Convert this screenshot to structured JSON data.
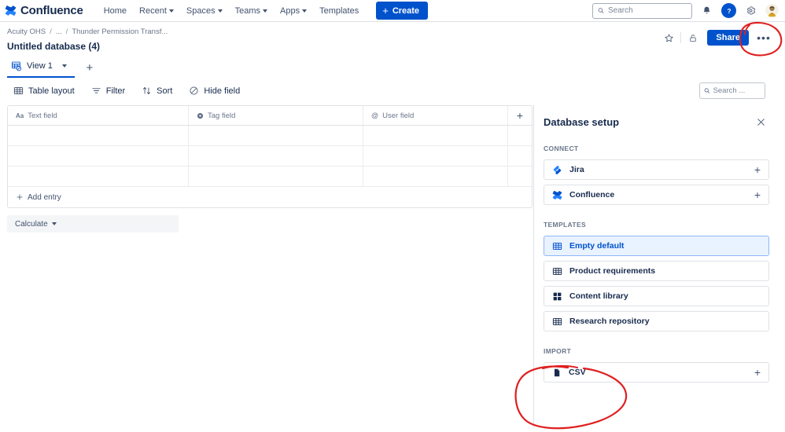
{
  "topnav": {
    "brand": "Confluence",
    "items": [
      {
        "label": "Home",
        "has_caret": false
      },
      {
        "label": "Recent",
        "has_caret": true
      },
      {
        "label": "Spaces",
        "has_caret": true
      },
      {
        "label": "Teams",
        "has_caret": true
      },
      {
        "label": "Apps",
        "has_caret": true
      },
      {
        "label": "Templates",
        "has_caret": false
      }
    ],
    "create_label": "Create",
    "search_placeholder": "Search",
    "search_value": "",
    "icons": [
      "notifications-bell-icon",
      "help-icon",
      "settings-gear-icon",
      "user-avatar"
    ]
  },
  "page": {
    "breadcrumb": [
      {
        "label": "Acuity OHS"
      },
      {
        "label": "..."
      },
      {
        "label": "Thunder Permission Transf..."
      }
    ],
    "breadcrumb_separator": "/",
    "title": "Untitled database (4)",
    "actions": {
      "star_label": "star-icon",
      "restrictions_label": "lock-icon",
      "share_label": "Share",
      "more_label": "•••"
    }
  },
  "views": {
    "tabs": [
      {
        "label": "View 1",
        "active": true
      }
    ],
    "add_view_label": "+"
  },
  "toolbar": {
    "items": [
      {
        "label": "Table layout",
        "icon": "table-layout-icon"
      },
      {
        "label": "Filter",
        "icon": "filter-icon"
      },
      {
        "label": "Sort",
        "icon": "sort-icon"
      },
      {
        "label": "Hide field",
        "icon": "hide-field-icon"
      }
    ],
    "search_placeholder": "Search ...",
    "search_value": ""
  },
  "table": {
    "columns": [
      {
        "label": "Text field",
        "icon": "text-field-icon",
        "icon_glyph": "Aa"
      },
      {
        "label": "Tag field",
        "icon": "tag-field-icon",
        "icon_glyph": ""
      },
      {
        "label": "User field",
        "icon": "user-field-icon",
        "icon_glyph": "@"
      }
    ],
    "add_column_label": "+",
    "rows": [
      [
        "",
        "",
        ""
      ],
      [
        "",
        "",
        ""
      ],
      [
        "",
        "",
        ""
      ]
    ],
    "add_entry_label": "Add entry",
    "calculate_label": "Calculate"
  },
  "panel": {
    "title": "Database setup",
    "close_label": "close-icon",
    "sections": [
      {
        "label": "CONNECT",
        "items": [
          {
            "label": "Jira",
            "icon": "jira-icon",
            "action": "+",
            "selected": false
          },
          {
            "label": "Confluence",
            "icon": "confluence-icon",
            "action": "+",
            "selected": false
          }
        ]
      },
      {
        "label": "TEMPLATES",
        "items": [
          {
            "label": "Empty default",
            "icon": "grid-template-icon",
            "action": "",
            "selected": true
          },
          {
            "label": "Product requirements",
            "icon": "grid-template-icon",
            "action": "",
            "selected": false
          },
          {
            "label": "Content library",
            "icon": "blocks-template-icon",
            "action": "",
            "selected": false
          },
          {
            "label": "Research repository",
            "icon": "grid-template-icon",
            "action": "",
            "selected": false
          }
        ]
      },
      {
        "label": "IMPORT",
        "items": [
          {
            "label": "CSV",
            "icon": "file-csv-icon",
            "action": "+",
            "selected": false
          }
        ]
      }
    ]
  },
  "annotations": {
    "color": "#e02020",
    "marks": [
      {
        "name": "ellipse-around-more-button",
        "target": "more-actions-button"
      },
      {
        "name": "ellipse-around-import-section",
        "target": "import-section"
      }
    ]
  }
}
